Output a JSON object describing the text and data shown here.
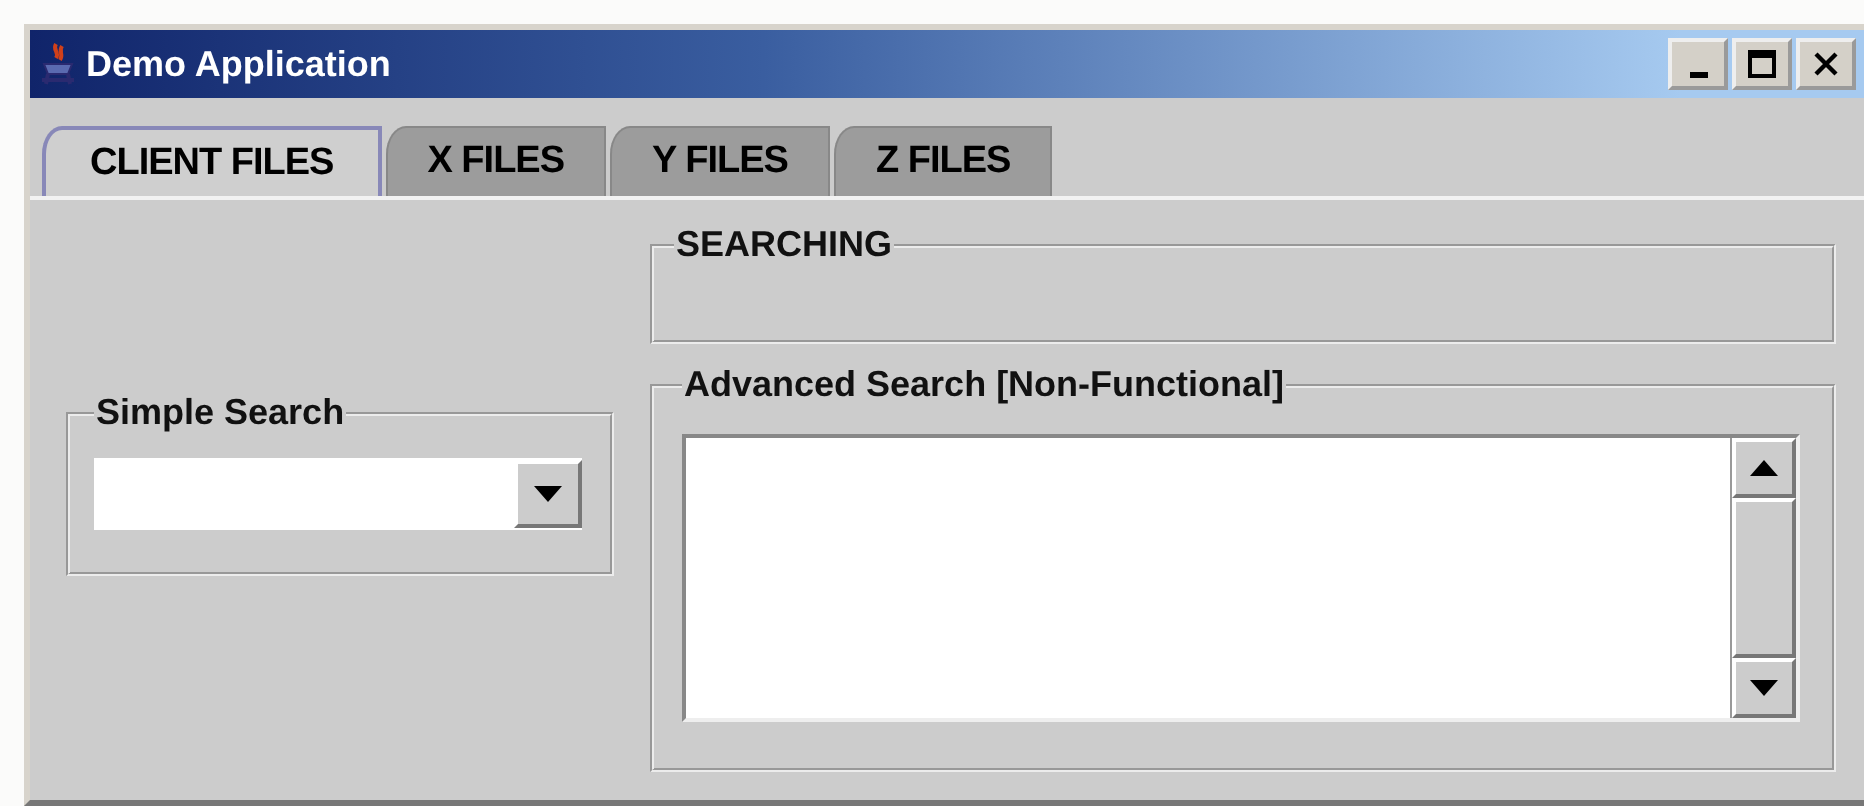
{
  "window": {
    "title": "Demo Application"
  },
  "tabs": [
    {
      "label": "CLIENT FILES",
      "selected": true
    },
    {
      "label": "X FILES",
      "selected": false
    },
    {
      "label": "Y FILES",
      "selected": false
    },
    {
      "label": "Z FILES",
      "selected": false
    }
  ],
  "simple_search": {
    "title": "Simple Search"
  },
  "searching": {
    "title": "SEARCHING"
  },
  "advanced_search": {
    "title": "Advanced Search [Non-Functional]"
  }
}
